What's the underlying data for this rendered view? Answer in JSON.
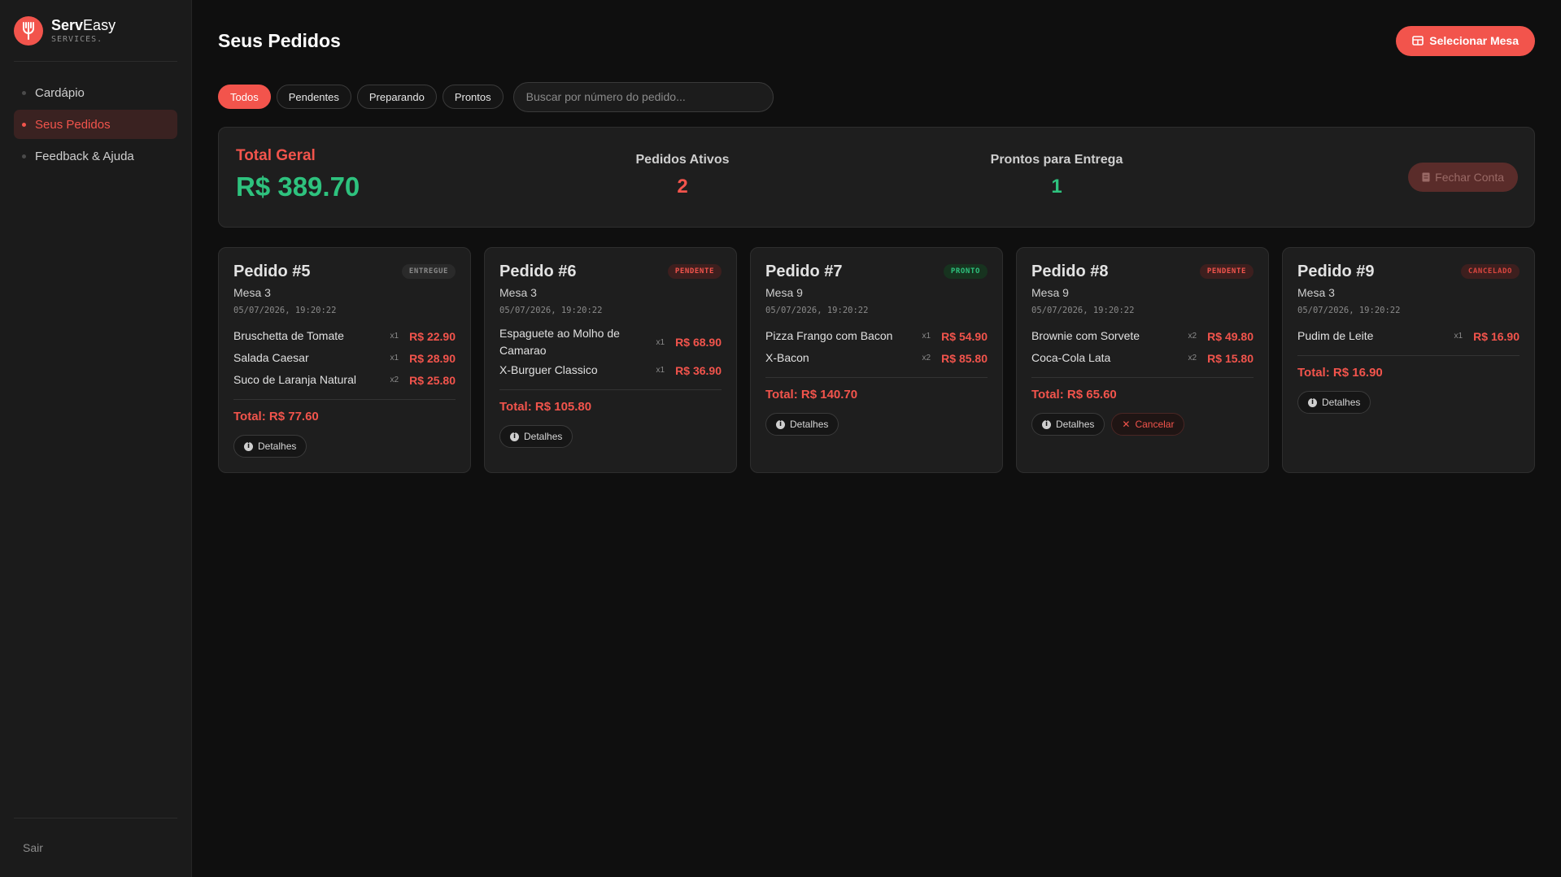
{
  "brand": {
    "name_bold": "Serv",
    "name_rest": "Easy",
    "subtitle": "SERVICES."
  },
  "sidebar": {
    "items": [
      {
        "label": "Cardápio",
        "active": false
      },
      {
        "label": "Seus Pedidos",
        "active": true
      },
      {
        "label": "Feedback & Ajuda",
        "active": false
      }
    ],
    "logout": "Sair"
  },
  "header": {
    "title": "Seus Pedidos",
    "select_table_button": "Selecionar Mesa"
  },
  "filters": {
    "tabs": [
      "Todos",
      "Pendentes",
      "Preparando",
      "Prontos"
    ],
    "active": "Todos",
    "search_placeholder": "Buscar por número do pedido..."
  },
  "summary": {
    "total_label": "Total Geral",
    "total_value": "R$ 389.70",
    "active_label": "Pedidos Ativos",
    "active_value": "2",
    "ready_label": "Prontos para Entrega",
    "ready_value": "1",
    "close_button": "Fechar Conta"
  },
  "orders": [
    {
      "title": "Pedido #5",
      "status": "ENTREGUE",
      "status_class": "entregue",
      "table": "Mesa 3",
      "date": "05/07/2026, 19:20:22",
      "items": [
        {
          "name": "Bruschetta de Tomate",
          "qty": "x1",
          "price": "R$ 22.90"
        },
        {
          "name": "Salada Caesar",
          "qty": "x1",
          "price": "R$ 28.90"
        },
        {
          "name": "Suco de Laranja Natural",
          "qty": "x2",
          "price": "R$ 25.80"
        }
      ],
      "total": "Total: R$ 77.60",
      "details": "Detalhes",
      "cancel": null
    },
    {
      "title": "Pedido #6",
      "status": "PENDENTE",
      "status_class": "pendente",
      "table": "Mesa 3",
      "date": "05/07/2026, 19:20:22",
      "items": [
        {
          "name": "Espaguete ao Molho de Camarao",
          "qty": "x1",
          "price": "R$ 68.90"
        },
        {
          "name": "X-Burguer Classico",
          "qty": "x1",
          "price": "R$ 36.90"
        }
      ],
      "total": "Total: R$ 105.80",
      "details": "Detalhes",
      "cancel": null
    },
    {
      "title": "Pedido #7",
      "status": "PRONTO",
      "status_class": "pronto",
      "table": "Mesa 9",
      "date": "05/07/2026, 19:20:22",
      "items": [
        {
          "name": "Pizza Frango com Bacon",
          "qty": "x1",
          "price": "R$ 54.90"
        },
        {
          "name": "X-Bacon",
          "qty": "x2",
          "price": "R$ 85.80"
        }
      ],
      "total": "Total: R$ 140.70",
      "details": "Detalhes",
      "cancel": null
    },
    {
      "title": "Pedido #8",
      "status": "PENDENTE",
      "status_class": "pendente",
      "table": "Mesa 9",
      "date": "05/07/2026, 19:20:22",
      "items": [
        {
          "name": "Brownie com Sorvete",
          "qty": "x2",
          "price": "R$ 49.80"
        },
        {
          "name": "Coca-Cola Lata",
          "qty": "x2",
          "price": "R$ 15.80"
        }
      ],
      "total": "Total: R$ 65.60",
      "details": "Detalhes",
      "cancel": "Cancelar"
    },
    {
      "title": "Pedido #9",
      "status": "CANCELADO",
      "status_class": "cancelado",
      "table": "Mesa 3",
      "date": "05/07/2026, 19:20:22",
      "items": [
        {
          "name": "Pudim de Leite",
          "qty": "x1",
          "price": "R$ 16.90"
        }
      ],
      "total": "Total: R$ 16.90",
      "details": "Detalhes",
      "cancel": null
    }
  ],
  "colors": {
    "accent": "#f2544c",
    "success": "#2ec27e",
    "background": "#0f0f0f",
    "card": "#1e1e1e"
  },
  "icons": {
    "logo": "fork-icon",
    "select_table": "table-grid-icon",
    "close_bill": "receipt-icon",
    "details": "info-icon",
    "cancel": "x-icon"
  }
}
